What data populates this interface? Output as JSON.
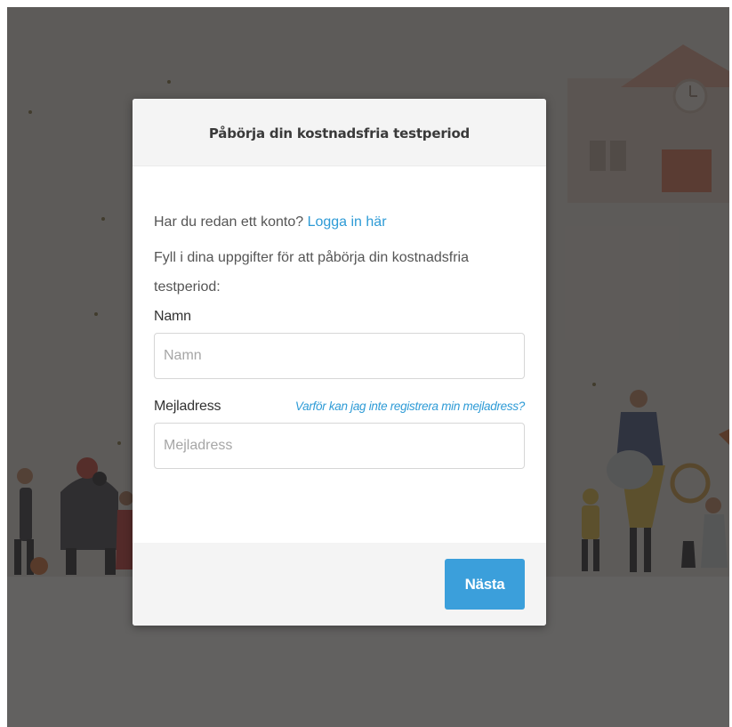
{
  "modal": {
    "title": "Påbörja din kostnadsfria testperiod",
    "login_prompt": "Har du redan ett konto?",
    "login_link": "Logga in här",
    "intro": "Fyll i dina uppgifter för att påbörja din kostnadsfria testperiod:",
    "name_field": {
      "label": "Namn",
      "placeholder": "Namn",
      "value": ""
    },
    "email_field": {
      "label": "Mejladress",
      "placeholder": "Mejladress",
      "value": "",
      "help_link": "Varför kan jag inte registrera min mejladress?"
    },
    "next_button": "Nästa"
  },
  "colors": {
    "accent": "#3b9fdb",
    "link": "#2e9bd6",
    "overlay": "#262422"
  }
}
